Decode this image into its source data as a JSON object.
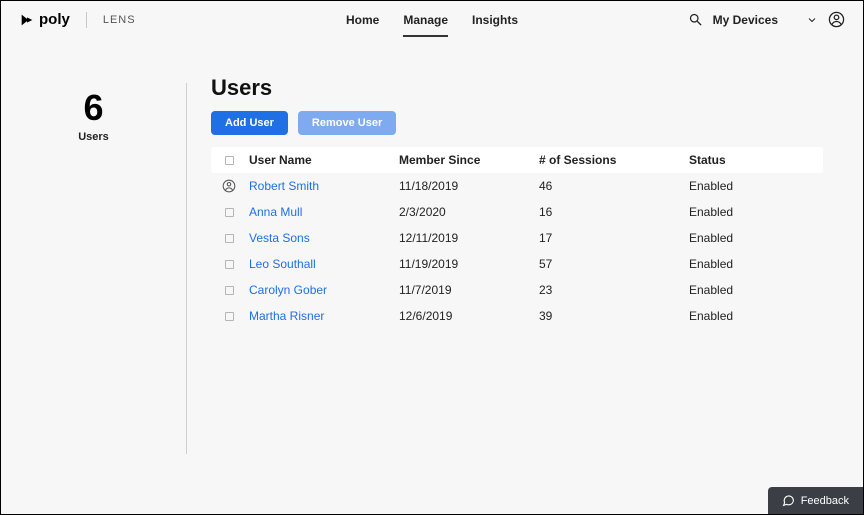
{
  "brand": {
    "name": "poly",
    "sub": "LENS"
  },
  "nav": {
    "items": [
      {
        "label": "Home",
        "active": false
      },
      {
        "label": "Manage",
        "active": true
      },
      {
        "label": "Insights",
        "active": false
      }
    ]
  },
  "topRight": {
    "myDevices": "My Devices"
  },
  "sidebar": {
    "count": "6",
    "label": "Users"
  },
  "page": {
    "title": "Users"
  },
  "actions": {
    "add": "Add User",
    "remove": "Remove User"
  },
  "columns": {
    "userName": "User Name",
    "memberSince": "Member Since",
    "sessions": "# of Sessions",
    "status": "Status"
  },
  "rows": [
    {
      "name": "Robert Smith",
      "since": "11/18/2019",
      "sessions": "46",
      "status": "Enabled",
      "icon": true
    },
    {
      "name": "Anna Mull",
      "since": "2/3/2020",
      "sessions": "16",
      "status": "Enabled",
      "icon": false
    },
    {
      "name": "Vesta Sons",
      "since": "12/11/2019",
      "sessions": "17",
      "status": "Enabled",
      "icon": false
    },
    {
      "name": "Leo Southall",
      "since": "11/19/2019",
      "sessions": "57",
      "status": "Enabled",
      "icon": false
    },
    {
      "name": "Carolyn Gober",
      "since": "11/7/2019",
      "sessions": "23",
      "status": "Enabled",
      "icon": false
    },
    {
      "name": "Martha Risner",
      "since": "12/6/2019",
      "sessions": "39",
      "status": "Enabled",
      "icon": false
    }
  ],
  "feedback": {
    "label": "Feedback"
  }
}
